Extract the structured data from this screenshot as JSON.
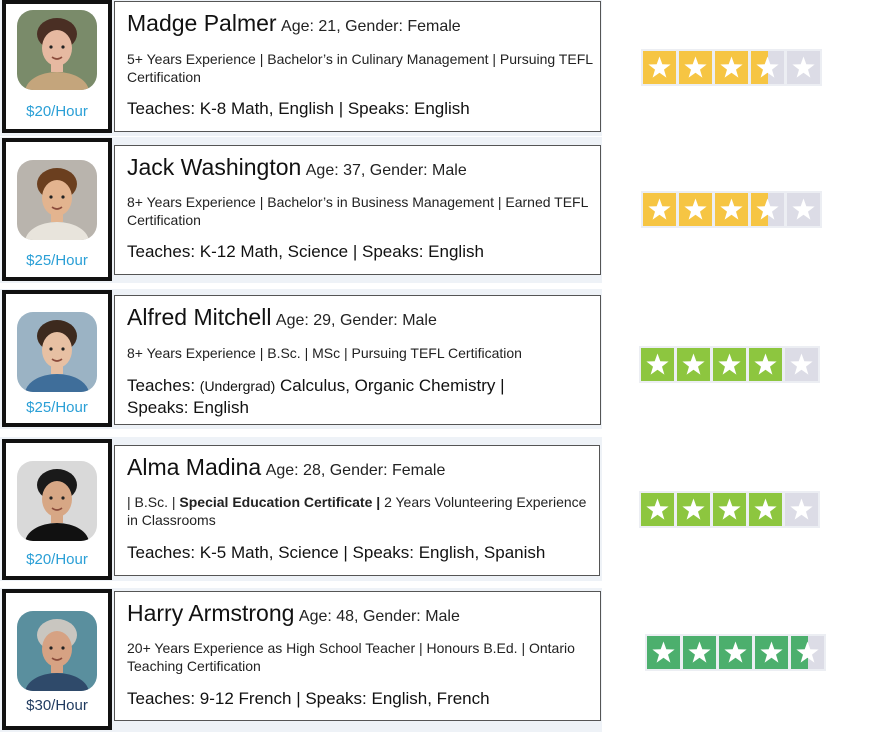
{
  "tutors": [
    {
      "name": "Madge Palmer",
      "meta": "Age: 21, Gender: Female",
      "experience": "5+ Years Experience | Bachelor’s in Culinary Management | Pursuing TEFL Certification",
      "teaches_label": "Teaches:",
      "teaches_prefix": "",
      "teaches": "K-8 Math, English",
      "speaks": "| Speaks: English",
      "rate": "$20/Hour",
      "rate_color": "#2a9fd6",
      "rating": 3.5,
      "star_color": "#f6c543"
    },
    {
      "name": "Jack Washington",
      "meta": "Age: 37, Gender: Male",
      "experience": "8+ Years Experience | Bachelor’s in Business Management | Earned TEFL Certification",
      "teaches_label": "Teaches:",
      "teaches_prefix": "",
      "teaches": "K-12 Math, Science",
      "speaks": "| Speaks: English",
      "rate": "$25/Hour",
      "rate_color": "#2a9fd6",
      "rating": 3.5,
      "star_color": "#f6c543"
    },
    {
      "name": "Alfred Mitchell",
      "meta": "Age: 29, Gender: Male",
      "experience": "8+ Years Experience | B.Sc. | MSc | Pursuing TEFL Certification",
      "teaches_label": "Teaches:",
      "teaches_prefix": "(Undergrad)",
      "teaches": "Calculus, Organic Chemistry |",
      "speaks": "Speaks: English",
      "rate": "$25/Hour",
      "rate_color": "#2a9fd6",
      "rating": 4,
      "star_color": "#8dc63f"
    },
    {
      "name": "Alma Madina",
      "meta": "Age: 28, Gender: Female",
      "experience_pre": "| B.Sc. |",
      "experience_bold": "Special Education Certificate |",
      "experience_post": "2 Years Volunteering Experience in Classrooms",
      "teaches_label": "Teaches:",
      "teaches_prefix": "",
      "teaches": "K-5 Math, Science",
      "speaks": "| Speaks: English, Spanish",
      "rate": "$20/Hour",
      "rate_color": "#2a9fd6",
      "rating": 4,
      "star_color": "#8dc63f"
    },
    {
      "name": "Harry Armstrong",
      "meta": "Age: 48, Gender: Male",
      "experience": "20+ Years Experience as High School Teacher | Honours B.Ed. | Ontario Teaching Certification",
      "teaches_label": "Teaches:",
      "teaches_prefix": "",
      "teaches": "9-12 French",
      "speaks": "| Speaks: English, French",
      "rate": "$30/Hour",
      "rate_color": "#1f3a5f",
      "rating": 4.5,
      "star_color": "#4caf6d"
    }
  ],
  "avatar_colors": [
    {
      "bg": "#7a8b6a",
      "skin": "#e6b9a1",
      "hair": "#4a2f24",
      "shirt": "#c4a57c"
    },
    {
      "bg": "#b9b4ad",
      "skin": "#e3b48f",
      "hair": "#6b3f1f",
      "shirt": "#e8e4dc"
    },
    {
      "bg": "#9bb3c4",
      "skin": "#e7c0a3",
      "hair": "#3d2a1e",
      "shirt": "#3f6e9a"
    },
    {
      "bg": "#d9d9d9",
      "skin": "#d7a785",
      "hair": "#1a1a1a",
      "shirt": "#111111"
    },
    {
      "bg": "#5a8f9e",
      "skin": "#d6a283",
      "hair": "#c9c6c0",
      "shirt": "#2f4a6a"
    }
  ]
}
